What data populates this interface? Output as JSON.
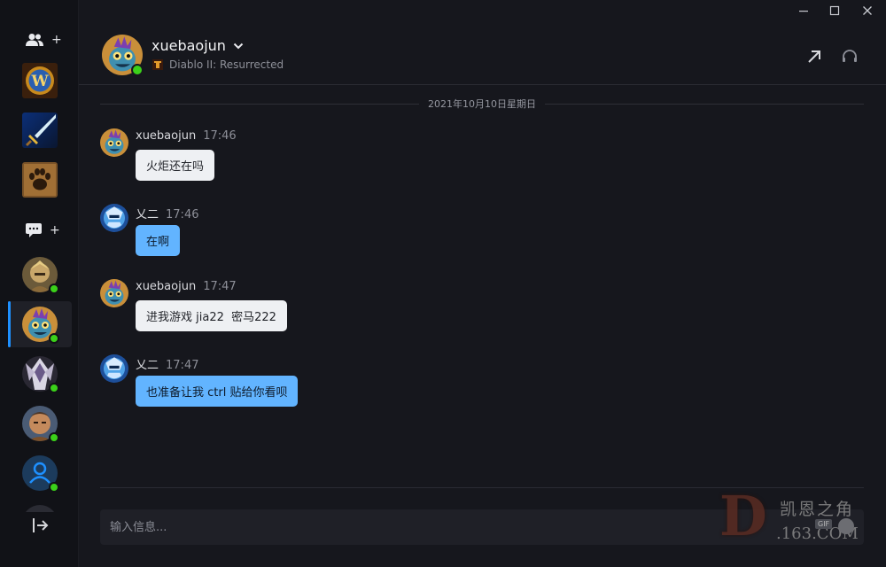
{
  "window": {
    "controls": {
      "minimize": "—",
      "maximize": "☐",
      "close": "✕"
    }
  },
  "sidebar": {
    "add_friend_plus": "+",
    "new_chat_plus": "+",
    "games": [
      {
        "name": "World of Warcraft",
        "icon": "wow-logo-icon",
        "glyph": "W"
      },
      {
        "name": "Sword game",
        "icon": "sword-icon"
      },
      {
        "name": "Paw game",
        "icon": "paw-icon"
      }
    ],
    "friends": [
      {
        "icon": "hero-avatar-1",
        "online": true
      },
      {
        "icon": "murloc-avatar",
        "online": true,
        "active": true
      },
      {
        "icon": "hero-avatar-3",
        "online": true
      },
      {
        "icon": "hero-avatar-4",
        "online": true
      },
      {
        "icon": "default-user-avatar",
        "online": true
      }
    ]
  },
  "header": {
    "contact_name": "xuebaojun",
    "game_name": "Diablo II: Resurrected",
    "online": true
  },
  "conversation": {
    "date": "2021年10月10日星期日",
    "messages": [
      {
        "sender": "xuebaojun",
        "time": "17:46",
        "text": "火炬还在吗",
        "style": "light",
        "avatar": "murloc-avatar"
      },
      {
        "sender": "乂二",
        "time": "17:46",
        "text": "在啊",
        "style": "blue",
        "avatar": "blue-hero-avatar"
      },
      {
        "sender": "xuebaojun",
        "time": "17:47",
        "text": "进我游戏 jia22  密马222",
        "style": "light",
        "avatar": "murloc-avatar"
      },
      {
        "sender": "乂二",
        "time": "17:47",
        "text": "也准备让我 ctrl 贴给你看呗",
        "style": "blue",
        "avatar": "blue-hero-avatar"
      }
    ]
  },
  "composer": {
    "placeholder": "输入信息...",
    "value": ""
  },
  "watermark": {
    "letter": "D",
    "site_name": "凯恩之角",
    "domain": ".163.COM",
    "badge": "GIF"
  },
  "colors": {
    "background": "#16171d",
    "sidebar": "#111217",
    "accent": "#1e90ff",
    "online": "#3bd11a",
    "bubble_light": "#eef0f3",
    "bubble_blue": "#62b4ff"
  }
}
